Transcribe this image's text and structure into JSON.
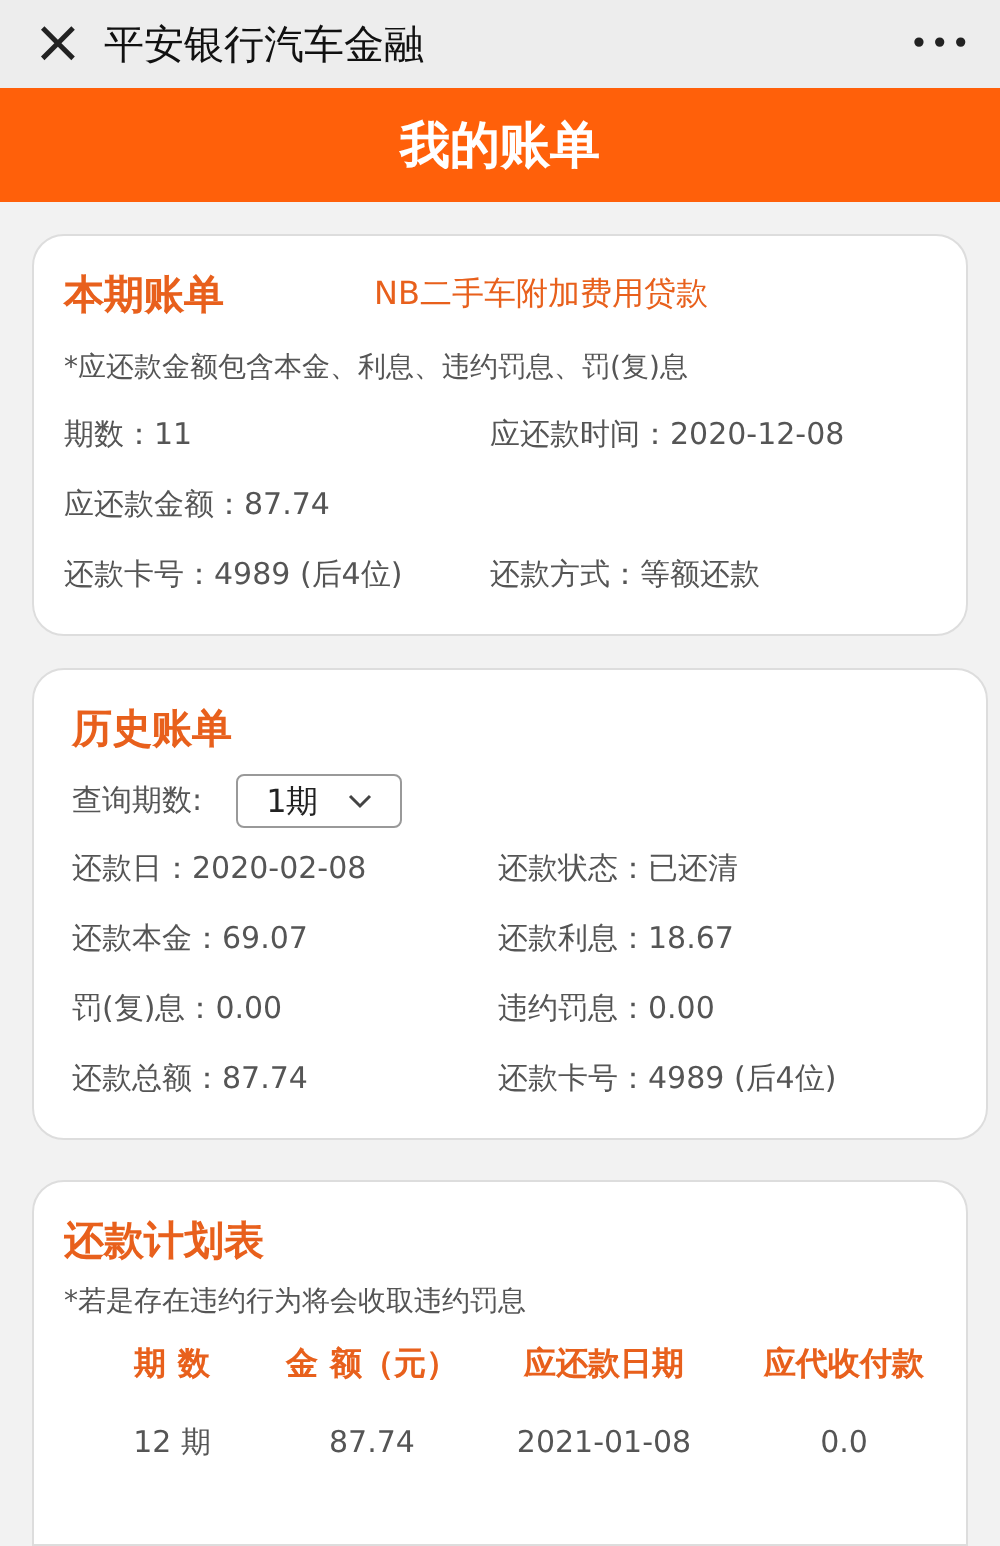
{
  "topbar": {
    "close": "×",
    "title": "平安银行汽车金融",
    "more": "•••"
  },
  "banner": {
    "title": "我的账单"
  },
  "current_bill": {
    "title": "本期账单",
    "product": "NB二手车附加费用贷款",
    "note": "*应还款金额包含本金、利息、违约罚息、罚(复)息",
    "rows": [
      [
        "期数：11",
        "应还款时间：2020-12-08"
      ],
      [
        "应还款金额：87.74"
      ],
      [
        "还款卡号：4989 (后4位)",
        "还款方式：等额还款"
      ]
    ]
  },
  "history_bill": {
    "title": "历史账单",
    "query_label": "查询期数:",
    "period_select": "1期",
    "rows": [
      [
        "还款日：2020-02-08",
        "还款状态：已还清"
      ],
      [
        "还款本金：69.07",
        "还款利息：18.67"
      ],
      [
        "罚(复)息：0.00",
        "违约罚息：0.00"
      ],
      [
        "还款总额：87.74",
        "还款卡号：4989 (后4位)"
      ]
    ]
  },
  "schedule": {
    "title": "还款计划表",
    "note": "*若是存在违约行为将会收取违约罚息",
    "columns": [
      "期 数",
      "金 额（元）",
      "应还款日期",
      "应代收付款"
    ],
    "rows": [
      [
        "12 期",
        "87.74",
        "2021-01-08",
        "0.0"
      ]
    ]
  }
}
